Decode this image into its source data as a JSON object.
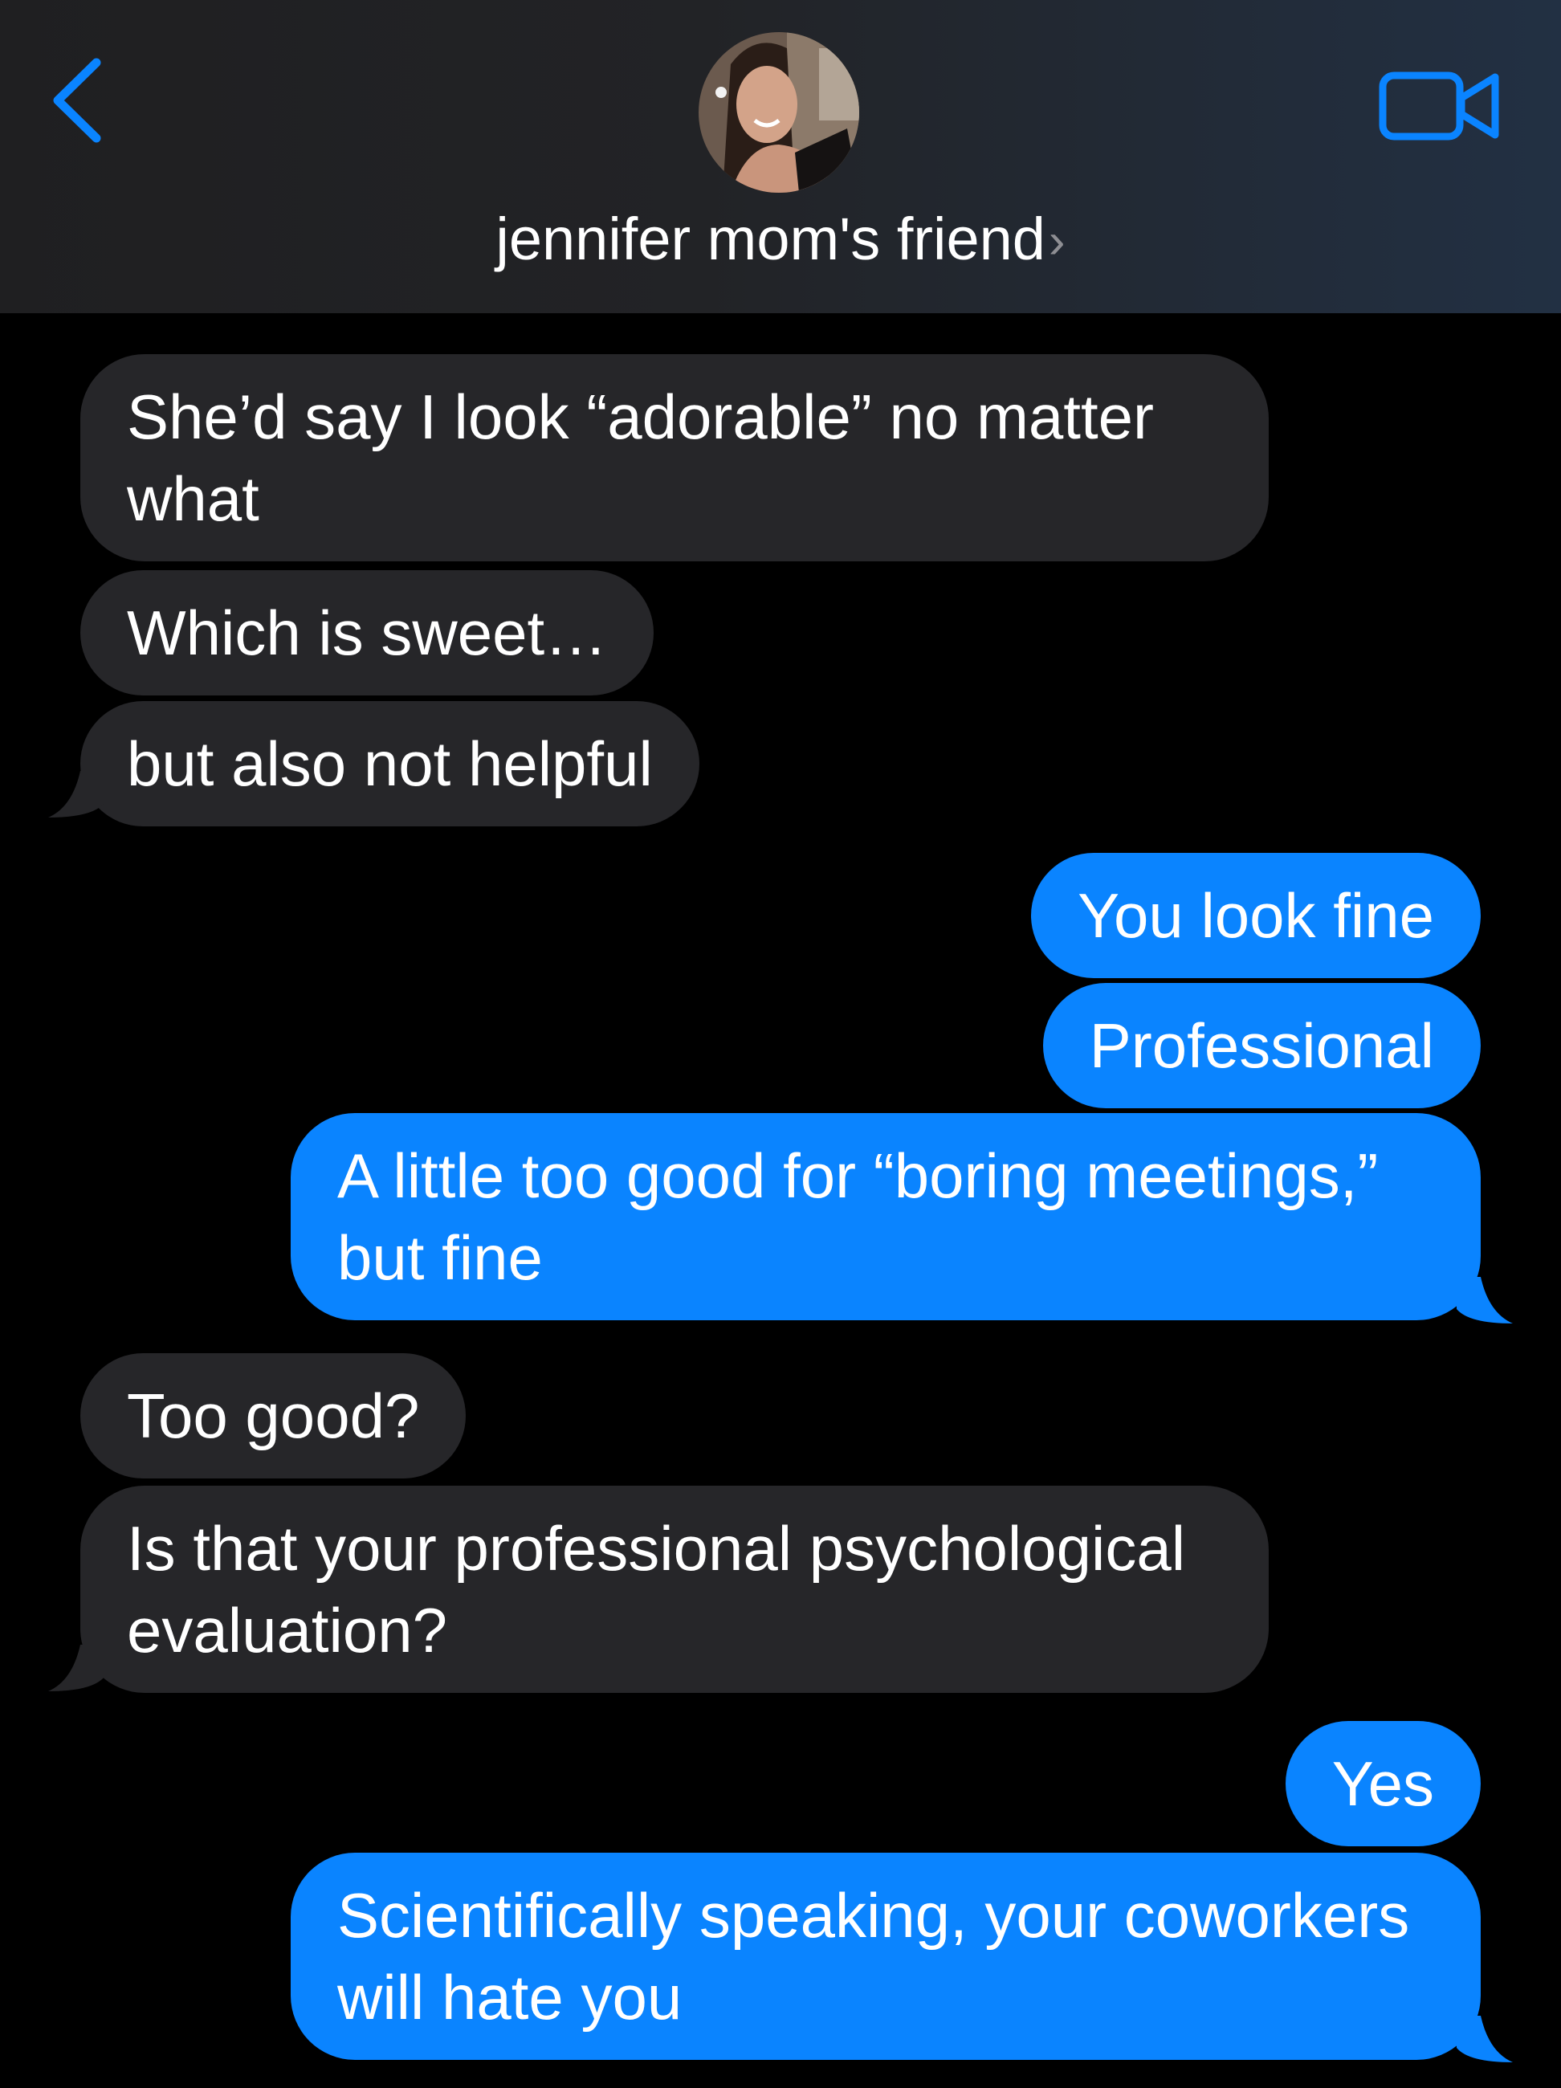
{
  "header": {
    "contact_name": "jennifer mom's friend",
    "chevron": "›",
    "back_icon": "chevron-left-icon",
    "video_icon": "video-camera-icon",
    "accent_color": "#0a84ff"
  },
  "messages": [
    {
      "direction": "incoming",
      "text": "She’d say I look “adorable” no matter what"
    },
    {
      "direction": "incoming",
      "text": "Which is sweet…"
    },
    {
      "direction": "incoming",
      "text": "but also not helpful"
    },
    {
      "direction": "outgoing",
      "text": "You look fine"
    },
    {
      "direction": "outgoing",
      "text": "Professional"
    },
    {
      "direction": "outgoing",
      "text": "A little too good for “boring meetings,” but fine"
    },
    {
      "direction": "incoming",
      "text": "Too good?"
    },
    {
      "direction": "incoming",
      "text": "Is that your professional psychological evaluation?"
    },
    {
      "direction": "outgoing",
      "text": "Yes"
    },
    {
      "direction": "outgoing",
      "text": "Scientifically speaking, your coworkers will hate you"
    }
  ],
  "colors": {
    "incoming_bubble": "#262629",
    "outgoing_bubble": "#0a84ff",
    "background": "#000000"
  }
}
